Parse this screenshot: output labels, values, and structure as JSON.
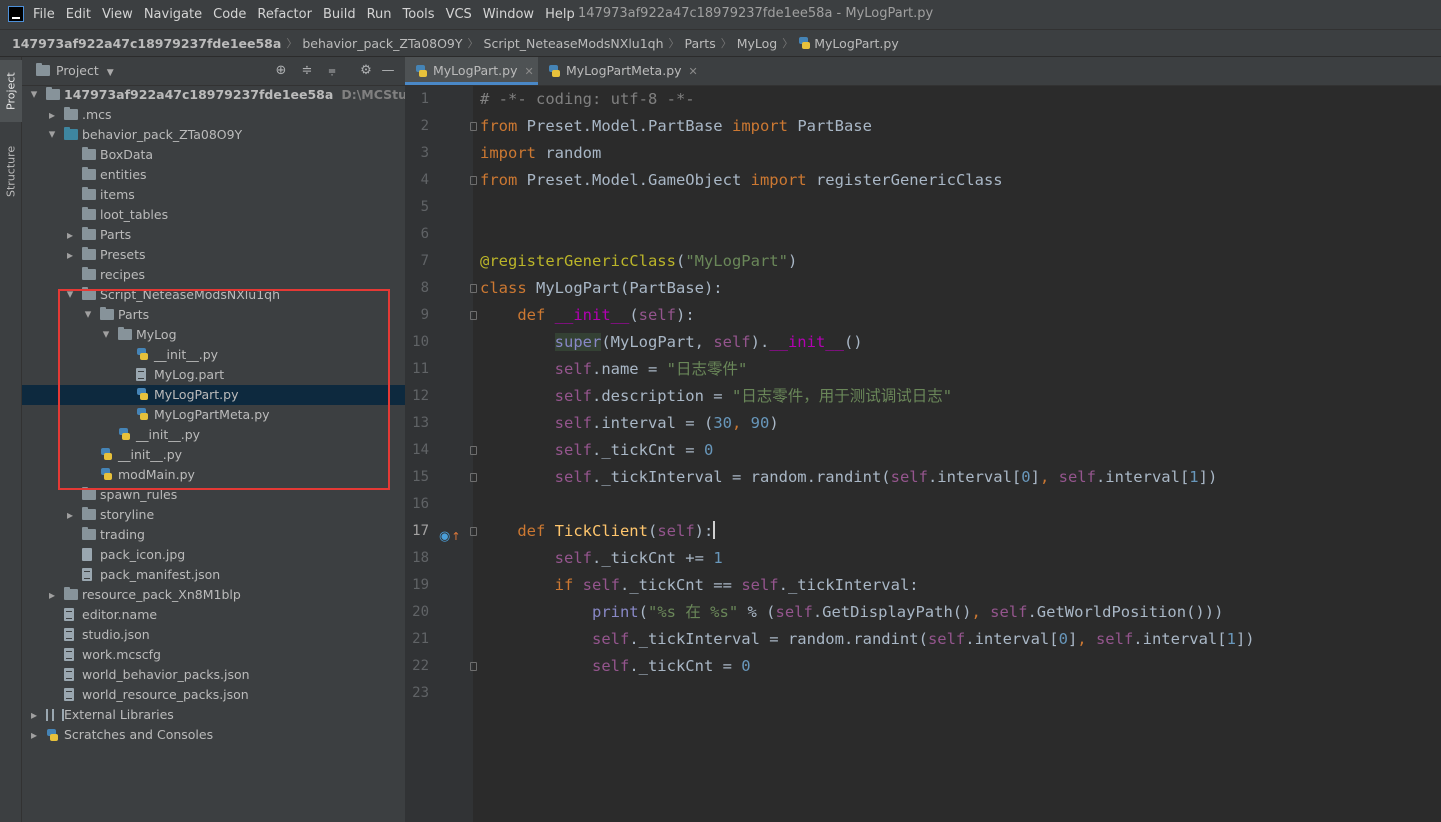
{
  "menubar": {
    "items": [
      "File",
      "Edit",
      "View",
      "Navigate",
      "Code",
      "Refactor",
      "Build",
      "Run",
      "Tools",
      "VCS",
      "Window",
      "Help"
    ],
    "window_title": "147973af922a47c18979237fde1ee58a - MyLogPart.py"
  },
  "breadcrumb": [
    "147973af922a47c18979237fde1ee58a",
    "behavior_pack_ZTa08O9Y",
    "Script_NeteaseModsNXlu1qh",
    "Parts",
    "MyLog",
    "MyLogPart.py"
  ],
  "toolstrip": {
    "project_label": "Project",
    "structure_label": "Structure"
  },
  "project_panel": {
    "title": "Project",
    "tree": [
      {
        "label": "147973af922a47c18979237fde1ee58a",
        "hint": "D:\\MCStudioDownlo",
        "depth": 0,
        "expand": "open",
        "icon": "folder",
        "bold": true
      },
      {
        "label": ".mcs",
        "depth": 1,
        "expand": "closed",
        "icon": "folder"
      },
      {
        "label": "behavior_pack_ZTa08O9Y",
        "depth": 1,
        "expand": "open",
        "icon": "folder-blue"
      },
      {
        "label": "BoxData",
        "depth": 2,
        "expand": "none",
        "icon": "folder"
      },
      {
        "label": "entities",
        "depth": 2,
        "expand": "none",
        "icon": "folder"
      },
      {
        "label": "items",
        "depth": 2,
        "expand": "none",
        "icon": "folder"
      },
      {
        "label": "loot_tables",
        "depth": 2,
        "expand": "none",
        "icon": "folder"
      },
      {
        "label": "Parts",
        "depth": 2,
        "expand": "closed",
        "icon": "folder"
      },
      {
        "label": "Presets",
        "depth": 2,
        "expand": "closed",
        "icon": "folder"
      },
      {
        "label": "recipes",
        "depth": 2,
        "expand": "none",
        "icon": "folder"
      },
      {
        "label": "Script_NeteaseModsNXlu1qh",
        "depth": 2,
        "expand": "open",
        "icon": "folder"
      },
      {
        "label": "Parts",
        "depth": 3,
        "expand": "open",
        "icon": "folder"
      },
      {
        "label": "MyLog",
        "depth": 4,
        "expand": "open",
        "icon": "folder-pkg"
      },
      {
        "label": "__init__.py",
        "depth": 5,
        "expand": "none",
        "icon": "py"
      },
      {
        "label": "MyLog.part",
        "depth": 5,
        "expand": "none",
        "icon": "text"
      },
      {
        "label": "MyLogPart.py",
        "depth": 5,
        "expand": "none",
        "icon": "py",
        "selected": true
      },
      {
        "label": "MyLogPartMeta.py",
        "depth": 5,
        "expand": "none",
        "icon": "py"
      },
      {
        "label": "__init__.py",
        "depth": 4,
        "expand": "none",
        "icon": "py"
      },
      {
        "label": "__init__.py",
        "depth": 3,
        "expand": "none",
        "icon": "py"
      },
      {
        "label": "modMain.py",
        "depth": 3,
        "expand": "none",
        "icon": "py"
      },
      {
        "label": "spawn_rules",
        "depth": 2,
        "expand": "none",
        "icon": "folder"
      },
      {
        "label": "storyline",
        "depth": 2,
        "expand": "closed",
        "icon": "folder"
      },
      {
        "label": "trading",
        "depth": 2,
        "expand": "none",
        "icon": "folder"
      },
      {
        "label": "pack_icon.jpg",
        "depth": 2,
        "expand": "none",
        "icon": "image"
      },
      {
        "label": "pack_manifest.json",
        "depth": 2,
        "expand": "none",
        "icon": "text"
      },
      {
        "label": "resource_pack_Xn8M1blp",
        "depth": 1,
        "expand": "closed",
        "icon": "folder"
      },
      {
        "label": "editor.name",
        "depth": 1,
        "expand": "none",
        "icon": "text"
      },
      {
        "label": "studio.json",
        "depth": 1,
        "expand": "none",
        "icon": "text"
      },
      {
        "label": "work.mcscfg",
        "depth": 1,
        "expand": "none",
        "icon": "text"
      },
      {
        "label": "world_behavior_packs.json",
        "depth": 1,
        "expand": "none",
        "icon": "text"
      },
      {
        "label": "world_resource_packs.json",
        "depth": 1,
        "expand": "none",
        "icon": "text"
      },
      {
        "label": "External Libraries",
        "depth": 0,
        "expand": "closed",
        "icon": "library"
      },
      {
        "label": "Scratches and Consoles",
        "depth": 0,
        "expand": "closed",
        "icon": "scratch"
      }
    ]
  },
  "tabs": [
    {
      "label": "MyLogPart.py",
      "active": true
    },
    {
      "label": "MyLogPartMeta.py",
      "active": false
    }
  ],
  "editor": {
    "current_line": 17,
    "lines": [
      [
        [
          "cm",
          "# -*- coding: utf-8 -*-"
        ]
      ],
      [
        [
          "kw",
          "from "
        ],
        [
          "",
          "Preset.Model.PartBase "
        ],
        [
          "kw",
          "import "
        ],
        [
          "",
          "PartBase"
        ]
      ],
      [
        [
          "kw",
          "import "
        ],
        [
          "",
          "random"
        ]
      ],
      [
        [
          "kw",
          "from "
        ],
        [
          "",
          "Preset.Model.GameObject "
        ],
        [
          "kw",
          "import "
        ],
        [
          "",
          "registerGenericClass"
        ]
      ],
      [],
      [],
      [
        [
          "dc",
          "@registerGenericClass"
        ],
        [
          "",
          "("
        ],
        [
          "st",
          "\"MyLogPart\""
        ],
        [
          "",
          ")"
        ]
      ],
      [
        [
          "kw",
          "class "
        ],
        [
          "",
          "MyLogPart(PartBase):"
        ]
      ],
      [
        [
          "",
          "    "
        ],
        [
          "kw",
          "def "
        ],
        [
          "mg",
          "__init__"
        ],
        [
          "",
          "("
        ],
        [
          "sf",
          "self"
        ],
        [
          "",
          "):"
        ]
      ],
      [
        [
          "",
          "        "
        ],
        [
          "sup",
          "super"
        ],
        [
          "",
          "(MyLogPart, "
        ],
        [
          "sf",
          "self"
        ],
        [
          "",
          ")."
        ],
        [
          "mg",
          "__init__"
        ],
        [
          "",
          "()"
        ]
      ],
      [
        [
          "",
          "        "
        ],
        [
          "sf",
          "self"
        ],
        [
          "",
          ".name = "
        ],
        [
          "st",
          "\"日志零件\""
        ]
      ],
      [
        [
          "",
          "        "
        ],
        [
          "sf",
          "self"
        ],
        [
          "",
          ".description = "
        ],
        [
          "st",
          "\"日志零件，用于测试调试日志\""
        ]
      ],
      [
        [
          "",
          "        "
        ],
        [
          "sf",
          "self"
        ],
        [
          "",
          ".interval = ("
        ],
        [
          "nu",
          "30"
        ],
        [
          "kw",
          ", "
        ],
        [
          "nu",
          "90"
        ],
        [
          "",
          ")"
        ]
      ],
      [
        [
          "",
          "        "
        ],
        [
          "sf",
          "self"
        ],
        [
          "",
          "._tickCnt = "
        ],
        [
          "nu",
          "0"
        ]
      ],
      [
        [
          "",
          "        "
        ],
        [
          "sf",
          "self"
        ],
        [
          "",
          "._tickInterval = random.randint("
        ],
        [
          "sf",
          "self"
        ],
        [
          "",
          ".interval["
        ],
        [
          "nu",
          "0"
        ],
        [
          "",
          "]"
        ],
        [
          "kw",
          ", "
        ],
        [
          "sf",
          "self"
        ],
        [
          "",
          ".interval["
        ],
        [
          "nu",
          "1"
        ],
        [
          "",
          "])"
        ]
      ],
      [],
      [
        [
          "",
          "    "
        ],
        [
          "kw",
          "def "
        ],
        [
          "fn",
          "TickClient"
        ],
        [
          "",
          "("
        ],
        [
          "sf",
          "self"
        ],
        [
          "",
          "):"
        ]
      ],
      [
        [
          "",
          "        "
        ],
        [
          "sf",
          "self"
        ],
        [
          "",
          "._tickCnt += "
        ],
        [
          "nu",
          "1"
        ]
      ],
      [
        [
          "",
          "        "
        ],
        [
          "kw",
          "if "
        ],
        [
          "sf",
          "self"
        ],
        [
          "",
          "._tickCnt == "
        ],
        [
          "sf",
          "self"
        ],
        [
          "",
          "._tickInterval:"
        ]
      ],
      [
        [
          "",
          "            "
        ],
        [
          "bi",
          "print"
        ],
        [
          "",
          "("
        ],
        [
          "st",
          "\"%s 在 %s\""
        ],
        [
          "",
          " % ("
        ],
        [
          "sf",
          "self"
        ],
        [
          "",
          ".GetDisplayPath()"
        ],
        [
          "kw",
          ", "
        ],
        [
          "sf",
          "self"
        ],
        [
          "",
          ".GetWorldPosition()))"
        ]
      ],
      [
        [
          "",
          "            "
        ],
        [
          "sf",
          "self"
        ],
        [
          "",
          "._tickInterval = random.randint("
        ],
        [
          "sf",
          "self"
        ],
        [
          "",
          ".interval["
        ],
        [
          "nu",
          "0"
        ],
        [
          "",
          "]"
        ],
        [
          "kw",
          ", "
        ],
        [
          "sf",
          "self"
        ],
        [
          "",
          ".interval["
        ],
        [
          "nu",
          "1"
        ],
        [
          "",
          "])"
        ]
      ],
      [
        [
          "",
          "            "
        ],
        [
          "sf",
          "self"
        ],
        [
          "",
          "._tickCnt = "
        ],
        [
          "nu",
          "0"
        ]
      ],
      []
    ],
    "fold_lines": [
      2,
      4,
      8,
      9,
      14,
      15,
      17,
      22
    ]
  }
}
